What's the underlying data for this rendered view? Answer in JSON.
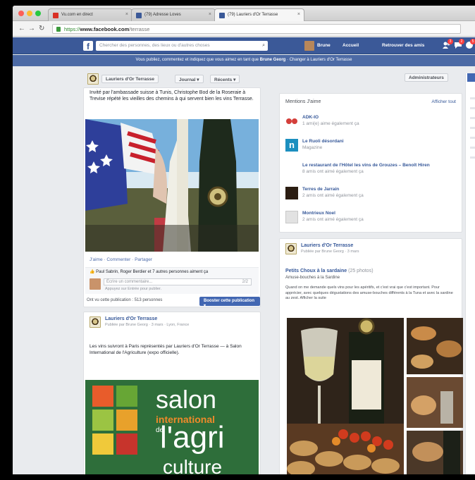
{
  "browser": {
    "tabs": [
      {
        "label": "Vu.com en direct"
      },
      {
        "label": "(79) Adresse Loves"
      },
      {
        "label": "(79) Lauriers d'Or Terrasse"
      }
    ],
    "url_scheme": "https://",
    "url_host": "www.facebook.com",
    "url_path": "/terrasse"
  },
  "fb_header": {
    "search_placeholder": "Chercher des personnes, des lieux ou d'autres choses",
    "nav_items": [
      "Brune",
      "Accueil",
      "Retrouver des amis"
    ],
    "badges": [
      "3",
      "2",
      "5"
    ]
  },
  "info_banner": {
    "text": "Vous publiez, commentez et indiquez que vous aimez en tant que",
    "name": "Brune Georg",
    "link": "Changer à Lauriers d'Or Terrasse"
  },
  "page_toolbar": {
    "page_name": "Lauriers d'Or Terrasse",
    "journal": "Journal",
    "recent": "Récents",
    "admin": "Administrateurs"
  },
  "post1": {
    "text": "Invité par l'ambassade suisse à Tunis, Christophe Bod de la Roseraie à Trevise répété les vieilles des chemins à qui servent bien les vins Terrasse.",
    "actions": "J'aime · Commenter · Partager",
    "likes": "Paul Sabrin, Roger Berdier et 7 autres personnes aiment ça",
    "comment_placeholder": "Écrire un commentaire...",
    "comment_count": "2/2",
    "comment_sub": "Appuyez sur Entrée pour publier.",
    "reach": "Ont vu cette publication : 513 personnes",
    "boost": "Booster cette publication"
  },
  "post2": {
    "author": "Lauriers d'Or Terrasse",
    "meta": "Publiée par Brune Georg · 3 mars · Lyon, France",
    "text": "Les vins suivront à Paris représentés par Lauriers d'Or Terrasse — à Salon International de l'Agriculture (expo officielle).",
    "sign_line1": "salon",
    "sign_line2": "international",
    "sign_line3": "de",
    "sign_line4": "l'agri",
    "sign_line5": "culture"
  },
  "mentions": {
    "title": "Mentions J'aime",
    "see_all": "Afficher tout",
    "items": [
      {
        "name": "ADK-IO",
        "sub": "1 ami(e) aime également ça",
        "color": "#d43f3a"
      },
      {
        "name": "Le Ruoli désordani",
        "sub": "Magazine",
        "color": "#1c8fbf"
      },
      {
        "name": "Le restaurant de l'Hôtel les vins de Grouzes – Benoît Hiren",
        "sub": "8 amis ont aimé également ça",
        "color": "#ffffff"
      },
      {
        "name": "Terres de Jarrain",
        "sub": "2 amis ont aimé également ça",
        "color": "#2b1d12"
      },
      {
        "name": "Montrieux Noel",
        "sub": "2 amis ont aimé également ça",
        "color": "#d8d8d8"
      }
    ]
  },
  "post3": {
    "author": "Lauriers d'Or Terrasse",
    "meta": "Publiée par Brune Georg · 3 mars",
    "title": "Petits Choux à la sardaine",
    "title_suffix": "(25 photos)",
    "subtitle": "Amuse-bouches à la Sardine",
    "text": "Quand on me demande quels vins pour les apéritifs, et c'est vrai que c'est important. Pour apprécier, avec quelques dégustations des amuse-bouches différents à la Tuna et avec la sardine au zest. Afficher la suite"
  },
  "colors": {
    "fb_blue": "#3b5998",
    "banner_blue": "#4c6aa5",
    "button_blue": "#4267b2",
    "page_bg": "#e9ebee"
  }
}
